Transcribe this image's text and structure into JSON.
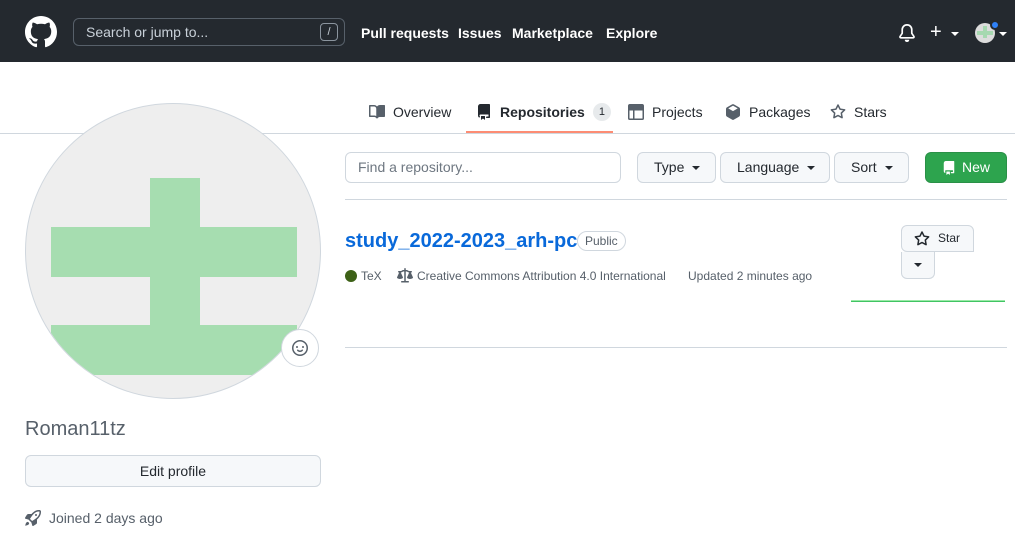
{
  "header": {
    "search_placeholder": "Search or jump to...",
    "search_shortcut": "/",
    "nav": [
      "Pull requests",
      "Issues",
      "Marketplace",
      "Explore"
    ]
  },
  "tabs": [
    {
      "label": "Overview",
      "icon": "book-icon"
    },
    {
      "label": "Repositories",
      "icon": "repo-icon",
      "count": "1",
      "selected": true
    },
    {
      "label": "Projects",
      "icon": "table-icon"
    },
    {
      "label": "Packages",
      "icon": "package-icon"
    },
    {
      "label": "Stars",
      "icon": "star-icon"
    }
  ],
  "profile": {
    "username": "Roman11tz",
    "edit_label": "Edit profile",
    "joined": "Joined 2 days ago"
  },
  "filters": {
    "find_placeholder": "Find a repository...",
    "type_label": "Type",
    "language_label": "Language",
    "sort_label": "Sort",
    "new_label": "New"
  },
  "repo": {
    "name": "study_2022-2023_arh-pc",
    "visibility": "Public",
    "language": "TeX",
    "language_color": "#3d6117",
    "license": "Creative Commons Attribution 4.0 International",
    "updated": "Updated 2 minutes ago",
    "star_label": "Star"
  },
  "colors": {
    "header_bg": "#24292f",
    "link": "#0969da",
    "primary_button": "#2da44e",
    "tab_underline": "#fd8c73",
    "avatar_pattern": "#a6ddb0"
  }
}
